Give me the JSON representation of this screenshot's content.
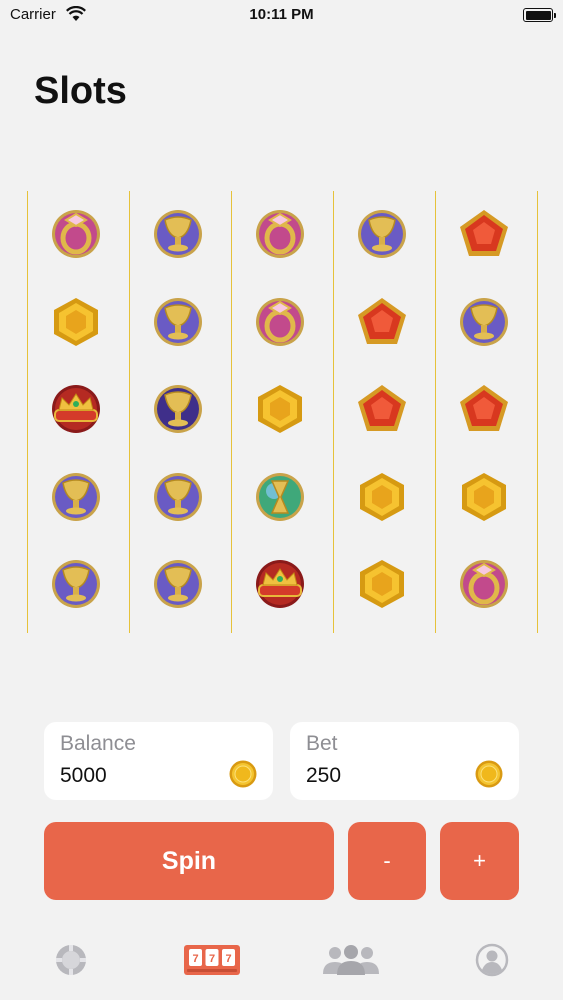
{
  "status_bar": {
    "carrier": "Carrier",
    "time": "10:11 PM"
  },
  "header": {
    "title": "Slots"
  },
  "reels": [
    [
      "ring-pink",
      "gem-hexagon",
      "crown",
      "chalice-purple",
      "chalice-purple"
    ],
    [
      "chalice-purple",
      "chalice-purple",
      "chalice-dark",
      "chalice-purple",
      "chalice-purple"
    ],
    [
      "ring-pink",
      "ring-pink",
      "gem-hexagon",
      "hourglass-green",
      "crown"
    ],
    [
      "chalice-purple",
      "gem-pentagon-red",
      "gem-pentagon-red",
      "gem-hexagon",
      "gem-hexagon"
    ],
    [
      "gem-pentagon-red",
      "chalice-purple",
      "gem-pentagon-red",
      "gem-hexagon",
      "ring-pink"
    ]
  ],
  "balance": {
    "label": "Balance",
    "value": "5000",
    "icon": "coin-icon"
  },
  "bet": {
    "label": "Bet",
    "value": "250",
    "icon": "coin-icon"
  },
  "controls": {
    "spin_label": "Spin",
    "decrease_label": "-",
    "increase_label": "+"
  },
  "colors": {
    "accent": "#e8664a",
    "reel_divider": "#e6c23a",
    "background": "#f2f2f2"
  },
  "tab_bar": [
    {
      "name": "chip-icon",
      "active": false
    },
    {
      "name": "slot-machine-icon",
      "active": true
    },
    {
      "name": "group-icon",
      "active": false
    },
    {
      "name": "profile-icon",
      "active": false
    }
  ]
}
